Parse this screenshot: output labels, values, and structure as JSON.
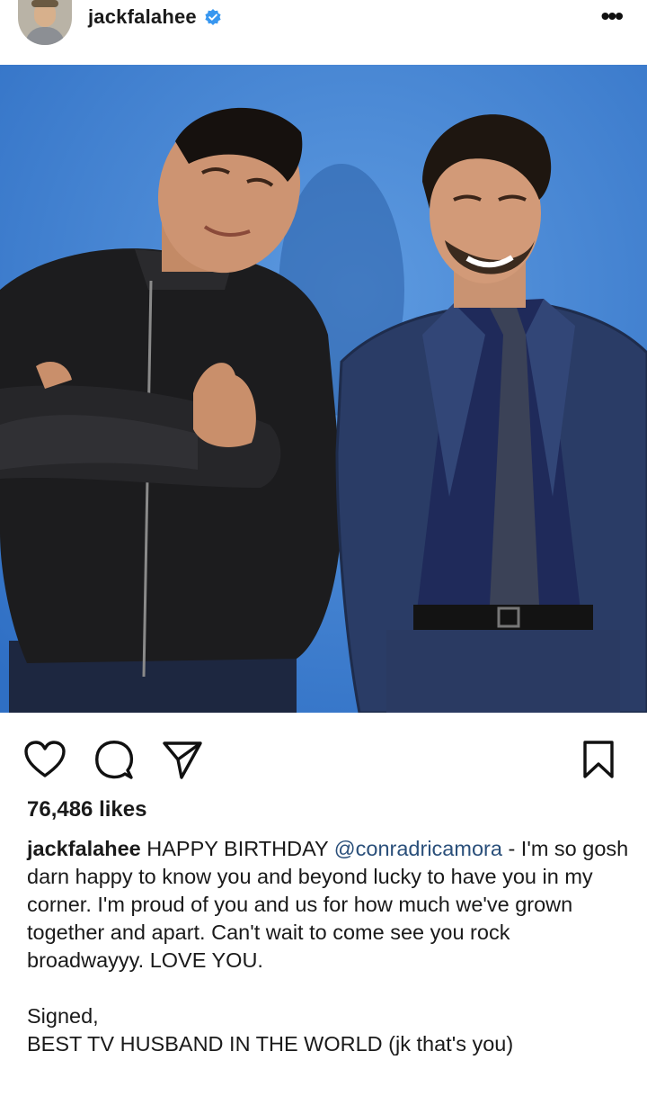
{
  "header": {
    "username": "jackfalahee",
    "more_icon": "more-dots-icon",
    "verified_icon": "verified-badge-icon",
    "verified_color": "#3897f0"
  },
  "post": {
    "background_color": "#3e7fd0"
  },
  "actions": {
    "icons": [
      "heart-icon",
      "comment-icon",
      "share-icon",
      "bookmark-icon"
    ]
  },
  "likes_text": "76,486 likes",
  "caption": {
    "username": "jackfalahee",
    "lead": "HAPPY BIRTHDAY",
    "mention": "@conradricamora",
    "body": "- I'm so gosh darn happy to know you and beyond lucky to have you in my corner. I'm proud of you and us for how much we've grown together and apart. Can't wait to come see you rock broadwayyy. LOVE YOU.",
    "signed_line": "Signed,",
    "signature": "BEST TV HUSBAND IN THE WORLD (jk that's you)",
    "mention_color": "#2a4f7a"
  }
}
